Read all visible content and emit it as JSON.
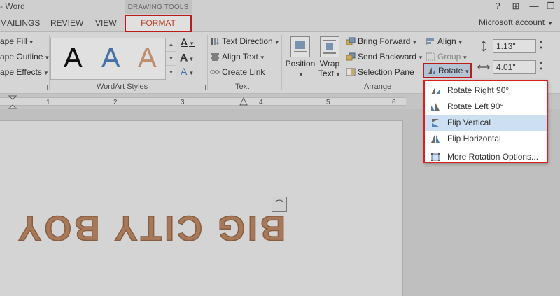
{
  "titlebar": {
    "app_title": "- Word",
    "context_label": "DRAWING TOOLS",
    "buttons": {
      "help": "?",
      "ribbon_options": "⊞",
      "minimize": "—",
      "restore": "❐"
    }
  },
  "tabs": {
    "mailings": "MAILINGS",
    "review": "REVIEW",
    "view": "VIEW",
    "format": "FORMAT",
    "account": "Microsoft account"
  },
  "ribbon": {
    "shape_styles": {
      "shape_fill": "ape Fill",
      "shape_outline": "ape Outline",
      "shape_effects": "ape Effects"
    },
    "wordart_styles": {
      "label": "WordArt Styles",
      "letters": [
        "A",
        "A",
        "A"
      ],
      "text_fill": "A",
      "text_outline": "A",
      "text_effects": "A"
    },
    "text": {
      "label": "Text",
      "text_direction": "Text Direction",
      "align_text": "Align Text",
      "create_link": "Create Link"
    },
    "arrange": {
      "label": "Arrange",
      "position": "Position",
      "wrap_text_1": "Wrap",
      "wrap_text_2": "Text",
      "bring_forward": "Bring Forward",
      "send_backward": "Send Backward",
      "selection_pane": "Selection Pane",
      "align": "Align",
      "group": "Group",
      "rotate": "Rotate"
    },
    "size": {
      "height": "1.13\"",
      "width": "4.01\""
    }
  },
  "ruler": {
    "numbers": [
      "1",
      "2",
      "3",
      "4",
      "5",
      "6"
    ]
  },
  "document": {
    "wordart_text": "BIG CITY BOY"
  },
  "rotate_menu": {
    "items": [
      {
        "label": "Rotate Right 90°",
        "icon": "rotate-right-icon"
      },
      {
        "label": "Rotate Left 90°",
        "icon": "rotate-left-icon"
      },
      {
        "label": "Flip Vertical",
        "icon": "flip-vertical-icon"
      },
      {
        "label": "Flip Horizontal",
        "icon": "flip-horizontal-icon"
      },
      {
        "label": "More Rotation Options...",
        "icon": "more-rotation-icon"
      }
    ]
  },
  "colors": {
    "highlight_red": "#d6201c",
    "format_tab_text": "#d24726",
    "menu_hover": "#cde0f3",
    "wordart_fill": "#c08a66"
  }
}
